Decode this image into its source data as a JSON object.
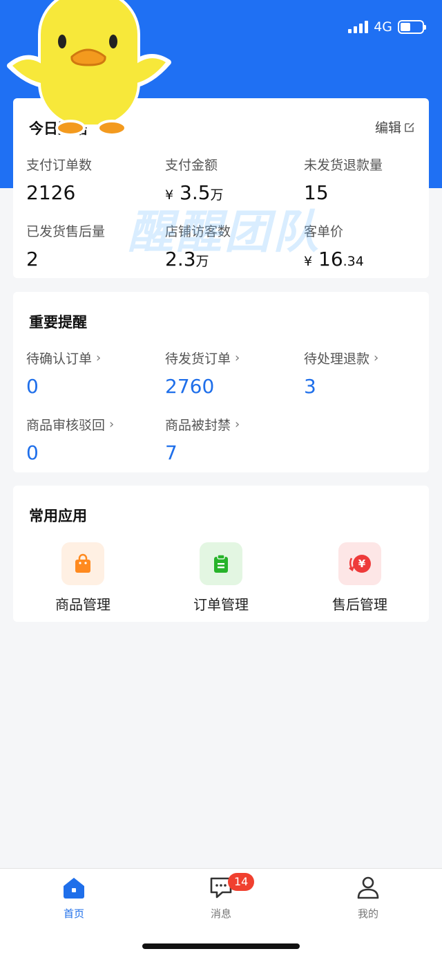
{
  "status_bar": {
    "network": "4G"
  },
  "today_card": {
    "title": "今日数据",
    "edit_label": "编辑",
    "stats": [
      {
        "label": "支付订单数",
        "value": "2126",
        "prefix": "",
        "suffix": ""
      },
      {
        "label": "支付金额",
        "value": "3.5",
        "prefix": "¥",
        "suffix": "万"
      },
      {
        "label": "未发货退款量",
        "value": "15",
        "prefix": "",
        "suffix": ""
      },
      {
        "label": "已发货售后量",
        "value": "2",
        "prefix": "",
        "suffix": ""
      },
      {
        "label": "店铺访客数",
        "value": "2.3",
        "prefix": "",
        "suffix": "万"
      },
      {
        "label": "客单价",
        "value": "16",
        "prefix": "¥",
        "suffix": ".34"
      }
    ]
  },
  "watermark": "醒醒团队",
  "reminders_card": {
    "title": "重要提醒",
    "items": [
      {
        "label": "待确认订单",
        "value": "0"
      },
      {
        "label": "待发货订单",
        "value": "2760"
      },
      {
        "label": "待处理退款",
        "value": "3"
      },
      {
        "label": "商品审核驳回",
        "value": "0"
      },
      {
        "label": "商品被封禁",
        "value": "7"
      }
    ]
  },
  "apps_card": {
    "title": "常用应用",
    "apps": [
      {
        "label": "商品管理",
        "icon": "shopping-bag-icon",
        "color": "#ff8a1f",
        "bg": "#fff0e3"
      },
      {
        "label": "订单管理",
        "icon": "clipboard-icon",
        "color": "#27b32a",
        "bg": "#e3f6e2"
      },
      {
        "label": "售后管理",
        "icon": "yen-refund-icon",
        "color": "#ee3a3a",
        "bg": "#fde6e6"
      }
    ]
  },
  "tabbar": {
    "tabs": [
      {
        "label": "首页",
        "icon": "home-icon",
        "active": true
      },
      {
        "label": "消息",
        "icon": "message-icon",
        "badge": "14"
      },
      {
        "label": "我的",
        "icon": "user-icon"
      }
    ]
  },
  "colors": {
    "primary": "#1f70f3",
    "badge": "#f0402f",
    "background": "#f5f6f8"
  }
}
